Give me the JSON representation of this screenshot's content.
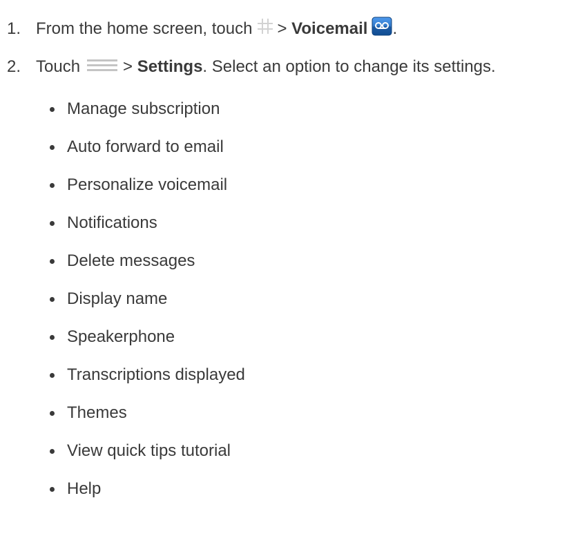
{
  "steps": [
    {
      "number": "1.",
      "prefix": "From the home screen, touch",
      "sep": ">",
      "bold": "Voicemail",
      "suffix": "."
    },
    {
      "number": "2.",
      "prefix": "Touch",
      "sep": ">",
      "bold": "Settings",
      "suffix": ". Select an option to change its settings."
    }
  ],
  "icons": {
    "step1_first": "apps-grid-icon",
    "step1_second": "voicemail-app-icon",
    "step2_first": "menu-icon",
    "voicemail_color": "#1e6fc9"
  },
  "options": [
    "Manage subscription",
    "Auto forward to email",
    "Personalize voicemail",
    "Notifications",
    "Delete messages",
    "Display name",
    "Speakerphone",
    "Transcriptions displayed",
    "Themes",
    "View quick tips tutorial",
    "Help"
  ]
}
